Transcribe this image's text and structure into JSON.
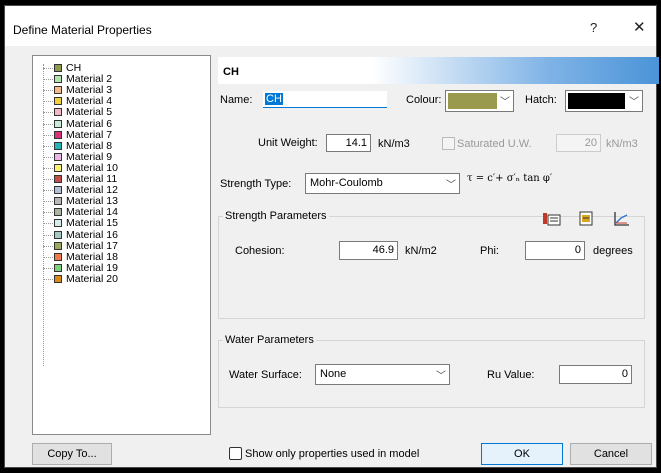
{
  "window": {
    "title": "Define Material Properties",
    "help": "?",
    "close": "✕"
  },
  "materials": [
    {
      "label": "CH",
      "color": "#8f9a4c"
    },
    {
      "label": "Material 2",
      "color": "#b5e3b0"
    },
    {
      "label": "Material 3",
      "color": "#f7b98a"
    },
    {
      "label": "Material 4",
      "color": "#f2cf3c"
    },
    {
      "label": "Material 5",
      "color": "#f4b6c2"
    },
    {
      "label": "Material 6",
      "color": "#c9ebd9"
    },
    {
      "label": "Material 7",
      "color": "#d8337a"
    },
    {
      "label": "Material 8",
      "color": "#26b3b3"
    },
    {
      "label": "Material 9",
      "color": "#e9b8e8"
    },
    {
      "label": "Material 10",
      "color": "#f7f27a"
    },
    {
      "label": "Material 11",
      "color": "#c2504a"
    },
    {
      "label": "Material 12",
      "color": "#b4c0d8"
    },
    {
      "label": "Material 13",
      "color": "#b8b8b8"
    },
    {
      "label": "Material 14",
      "color": "#a8b4a4"
    },
    {
      "label": "Material 15",
      "color": "#d6ecec"
    },
    {
      "label": "Material 16",
      "color": "#a5c8c4"
    },
    {
      "label": "Material 17",
      "color": "#9fa860"
    },
    {
      "label": "Material 18",
      "color": "#ef7a50"
    },
    {
      "label": "Material 19",
      "color": "#7fcf7a"
    },
    {
      "label": "Material 20",
      "color": "#d98a1c"
    }
  ],
  "header": {
    "label": "CH"
  },
  "form": {
    "name_label": "Name:",
    "name_value": "CH",
    "colour_label": "Colour:",
    "colour_value": "#9a9a4e",
    "hatch_label": "Hatch:",
    "hatch_value": "#000000",
    "unit_weight_label": "Unit Weight:",
    "unit_weight_value": "14.1",
    "unit_weight_unit": "kN/m3",
    "saturated_label": "Saturated U.W.",
    "saturated_value": "20",
    "saturated_unit": "kN/m3",
    "strength_type_label": "Strength Type:",
    "strength_type_value": "Mohr-Coulomb",
    "formula": "τ = c′+ σ′ₙ tan φ′"
  },
  "strength": {
    "title": "Strength Parameters",
    "cohesion_label": "Cohesion:",
    "cohesion_value": "46.9",
    "cohesion_unit": "kN/m2",
    "phi_label": "Phi:",
    "phi_value": "0",
    "phi_unit": "degrees"
  },
  "water": {
    "title": "Water Parameters",
    "surface_label": "Water Surface:",
    "surface_value": "None",
    "ru_label": "Ru Value:",
    "ru_value": "0"
  },
  "footer": {
    "copy_to": "Copy To...",
    "show_only": "Show only properties used in model",
    "ok": "OK",
    "cancel": "Cancel"
  }
}
